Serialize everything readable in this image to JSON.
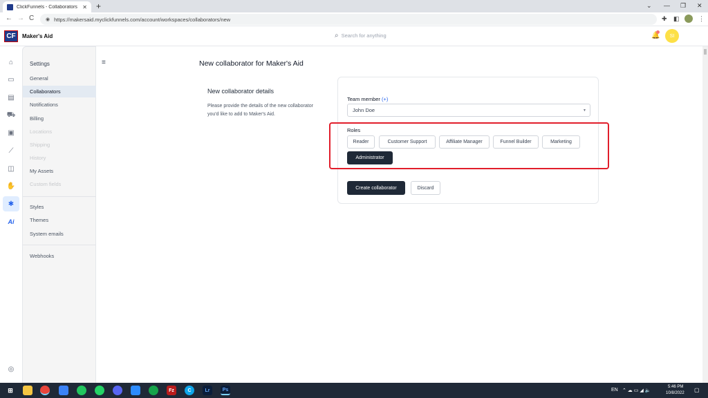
{
  "browser": {
    "tab_title": "ClickFunnels - Collaborators",
    "tab_close": "✕",
    "new_tab": "+",
    "url": "https://makersaid.myclickfunnels.com/account/workspaces/collaborators/new",
    "back": "←",
    "forward": "→",
    "reload": "C",
    "lock": "◉",
    "win_chevron": "⌄",
    "win_min": "—",
    "win_max": "❐",
    "win_close": "✕",
    "ext_icon": "✚",
    "sidepanel_icon": "◧",
    "menu_icon": "⋮"
  },
  "header": {
    "logo": "CF",
    "workspace_name": "Maker's Aid",
    "search_icon": "⌕",
    "search_placeholder": "Search for anything",
    "bell_icon": "🔔",
    "avatar_initials": "SI"
  },
  "rail": {
    "icons": [
      "home-icon",
      "calendar-icon",
      "shop-icon",
      "cart-icon",
      "chart-box-icon",
      "trend-icon",
      "payments-icon",
      "hand-icon",
      "gear-icon",
      "ai-icon"
    ],
    "glyphs": [
      "⌂",
      "▭",
      "▤",
      "⛟",
      "▣",
      "⟋",
      "◫",
      "✋",
      "✱",
      "Ai"
    ],
    "help_icon": "◎"
  },
  "sidebar": {
    "title": "Settings",
    "items": [
      {
        "label": "General",
        "state": "normal"
      },
      {
        "label": "Collaborators",
        "state": "active"
      },
      {
        "label": "Notifications",
        "state": "normal"
      },
      {
        "label": "Billing",
        "state": "normal"
      },
      {
        "label": "Locations",
        "state": "disabled"
      },
      {
        "label": "Shipping",
        "state": "disabled"
      },
      {
        "label": "History",
        "state": "disabled"
      },
      {
        "label": "My Assets",
        "state": "normal"
      },
      {
        "label": "Custom fields",
        "state": "disabled"
      }
    ],
    "group2": [
      {
        "label": "Styles"
      },
      {
        "label": "Themes"
      },
      {
        "label": "System emails"
      }
    ],
    "group3": [
      {
        "label": "Webhooks"
      }
    ]
  },
  "main": {
    "menu_icon": "≡",
    "page_title": "New collaborator for Maker's Aid",
    "section_title": "New collaborator details",
    "section_desc": "Please provide the details of the new collaborator you'd like to add to Maker's Aid.",
    "team_member_label": "Team member",
    "team_member_plus": "(+)",
    "team_member_value": "John Doe",
    "caret": "▼",
    "roles_label": "Roles",
    "roles": [
      {
        "label": "Reader",
        "selected": false
      },
      {
        "label": "Customer Support",
        "selected": false
      },
      {
        "label": "Affiliate Manager",
        "selected": false
      },
      {
        "label": "Funnel Builder",
        "selected": false
      },
      {
        "label": "Marketing",
        "selected": false
      },
      {
        "label": "Administrator",
        "selected": true
      }
    ],
    "create_button": "Create collaborator",
    "discard_button": "Discard",
    "highlight_color": "#e11d2a"
  },
  "taskbar": {
    "lang": "EN",
    "time": "5:46 PM",
    "date": "10/8/2022",
    "tray": "⌃ ☁ ▭ ◢ 🔈"
  }
}
